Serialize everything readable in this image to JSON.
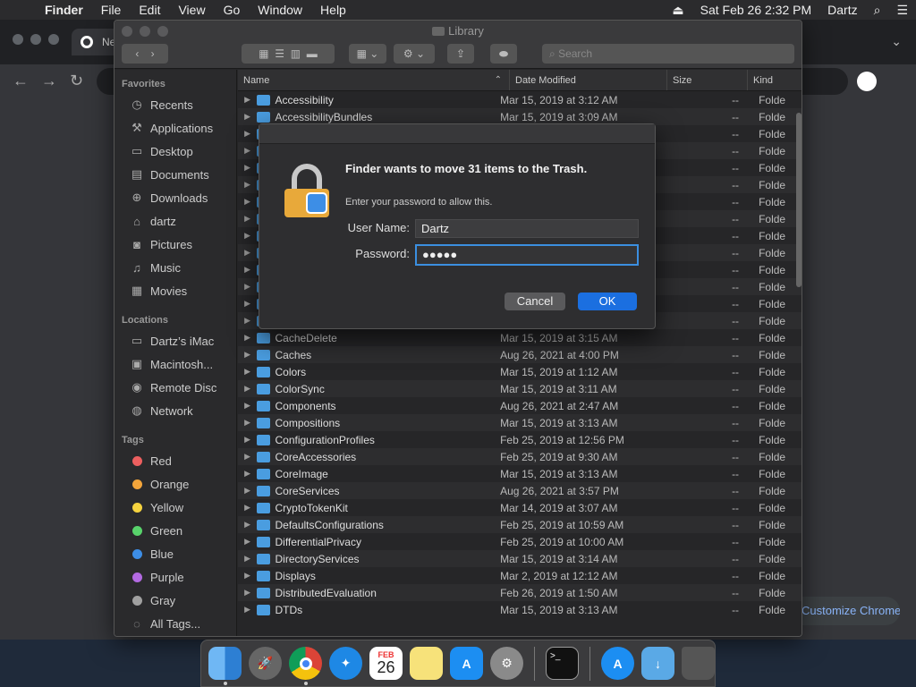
{
  "menubar": {
    "app": "Finder",
    "items": [
      "File",
      "Edit",
      "View",
      "Go",
      "Window",
      "Help"
    ],
    "datetime": "Sat Feb 26  2:32 PM",
    "user": "Dartz"
  },
  "chrome": {
    "tab_label": "Ne",
    "customize_label": "Customize Chrome"
  },
  "finder": {
    "title": "Library",
    "search_placeholder": "Search",
    "sidebar": {
      "favorites_header": "Favorites",
      "favorites": [
        "Recents",
        "Applications",
        "Desktop",
        "Documents",
        "Downloads",
        "dartz",
        "Pictures",
        "Music",
        "Movies"
      ],
      "locations_header": "Locations",
      "locations": [
        "Dartz’s iMac",
        "Macintosh...",
        "Remote Disc",
        "Network"
      ],
      "tags_header": "Tags",
      "tags": [
        {
          "label": "Red",
          "color": "#ec5f5f"
        },
        {
          "label": "Orange",
          "color": "#f3a53b"
        },
        {
          "label": "Yellow",
          "color": "#f5d33f"
        },
        {
          "label": "Green",
          "color": "#58d36b"
        },
        {
          "label": "Blue",
          "color": "#3d8ee6"
        },
        {
          "label": "Purple",
          "color": "#b36ae2"
        },
        {
          "label": "Gray",
          "color": "#a0a0a0"
        }
      ],
      "all_tags": "All Tags..."
    },
    "columns": {
      "name": "Name",
      "date": "Date Modified",
      "size": "Size",
      "kind": "Kind"
    },
    "rows": [
      {
        "name": "Accessibility",
        "date": "Mar 15, 2019 at 3:12 AM",
        "size": "--",
        "kind": "Folde"
      },
      {
        "name": "AccessibilityBundles",
        "date": "Mar 15, 2019 at 3:09 AM",
        "size": "--",
        "kind": "Folde"
      },
      {
        "name": "",
        "date": "",
        "size": "--",
        "kind": "Folde"
      },
      {
        "name": "",
        "date": "",
        "size": "--",
        "kind": "Folde"
      },
      {
        "name": "",
        "date": "",
        "size": "--",
        "kind": "Folde"
      },
      {
        "name": "",
        "date": "",
        "size": "--",
        "kind": "Folde"
      },
      {
        "name": "",
        "date": "",
        "size": "--",
        "kind": "Folde"
      },
      {
        "name": "",
        "date": "",
        "size": "--",
        "kind": "Folde"
      },
      {
        "name": "",
        "date": "",
        "size": "--",
        "kind": "Folde"
      },
      {
        "name": "",
        "date": "",
        "size": "--",
        "kind": "Folde"
      },
      {
        "name": "",
        "date": "",
        "size": "--",
        "kind": "Folde"
      },
      {
        "name": "",
        "date": "",
        "size": "--",
        "kind": "Folde"
      },
      {
        "name": "",
        "date": "",
        "size": "--",
        "kind": "Folde"
      },
      {
        "name": "",
        "date": "",
        "size": "--",
        "kind": "Folde"
      },
      {
        "name": "CacheDelete",
        "date": "Mar 15, 2019 at 3:15 AM",
        "size": "--",
        "kind": "Folde"
      },
      {
        "name": "Caches",
        "date": "Aug 26, 2021 at 4:00 PM",
        "size": "--",
        "kind": "Folde"
      },
      {
        "name": "Colors",
        "date": "Mar 15, 2019 at 1:12 AM",
        "size": "--",
        "kind": "Folde"
      },
      {
        "name": "ColorSync",
        "date": "Mar 15, 2019 at 3:11 AM",
        "size": "--",
        "kind": "Folde"
      },
      {
        "name": "Components",
        "date": "Aug 26, 2021 at 2:47 AM",
        "size": "--",
        "kind": "Folde"
      },
      {
        "name": "Compositions",
        "date": "Mar 15, 2019 at 3:13 AM",
        "size": "--",
        "kind": "Folde"
      },
      {
        "name": "ConfigurationProfiles",
        "date": "Feb 25, 2019 at 12:56 PM",
        "size": "--",
        "kind": "Folde"
      },
      {
        "name": "CoreAccessories",
        "date": "Feb 25, 2019 at 9:30 AM",
        "size": "--",
        "kind": "Folde"
      },
      {
        "name": "CoreImage",
        "date": "Mar 15, 2019 at 3:13 AM",
        "size": "--",
        "kind": "Folde"
      },
      {
        "name": "CoreServices",
        "date": "Aug 26, 2021 at 3:57 PM",
        "size": "--",
        "kind": "Folde"
      },
      {
        "name": "CryptoTokenKit",
        "date": "Mar 14, 2019 at 3:07 AM",
        "size": "--",
        "kind": "Folde"
      },
      {
        "name": "DefaultsConfigurations",
        "date": "Feb 25, 2019 at 10:59 AM",
        "size": "--",
        "kind": "Folde"
      },
      {
        "name": "DifferentialPrivacy",
        "date": "Feb 25, 2019 at 10:00 AM",
        "size": "--",
        "kind": "Folde"
      },
      {
        "name": "DirectoryServices",
        "date": "Mar 15, 2019 at 3:14 AM",
        "size": "--",
        "kind": "Folde"
      },
      {
        "name": "Displays",
        "date": "Mar 2, 2019 at 12:12 AM",
        "size": "--",
        "kind": "Folde"
      },
      {
        "name": "DistributedEvaluation",
        "date": "Feb 26, 2019 at 1:50 AM",
        "size": "--",
        "kind": "Folde"
      },
      {
        "name": "DTDs",
        "date": "Mar 15, 2019 at 3:13 AM",
        "size": "--",
        "kind": "Folde"
      }
    ]
  },
  "dialog": {
    "title": "Finder wants to move 31 items to the Trash.",
    "subtitle": "Enter your password to allow this.",
    "username_label": "User Name:",
    "username_value": "Dartz",
    "password_label": "Password:",
    "password_value": "●●●●●",
    "cancel_label": "Cancel",
    "ok_label": "OK"
  },
  "dock": {
    "calendar_month": "FEB",
    "calendar_day": "26"
  }
}
